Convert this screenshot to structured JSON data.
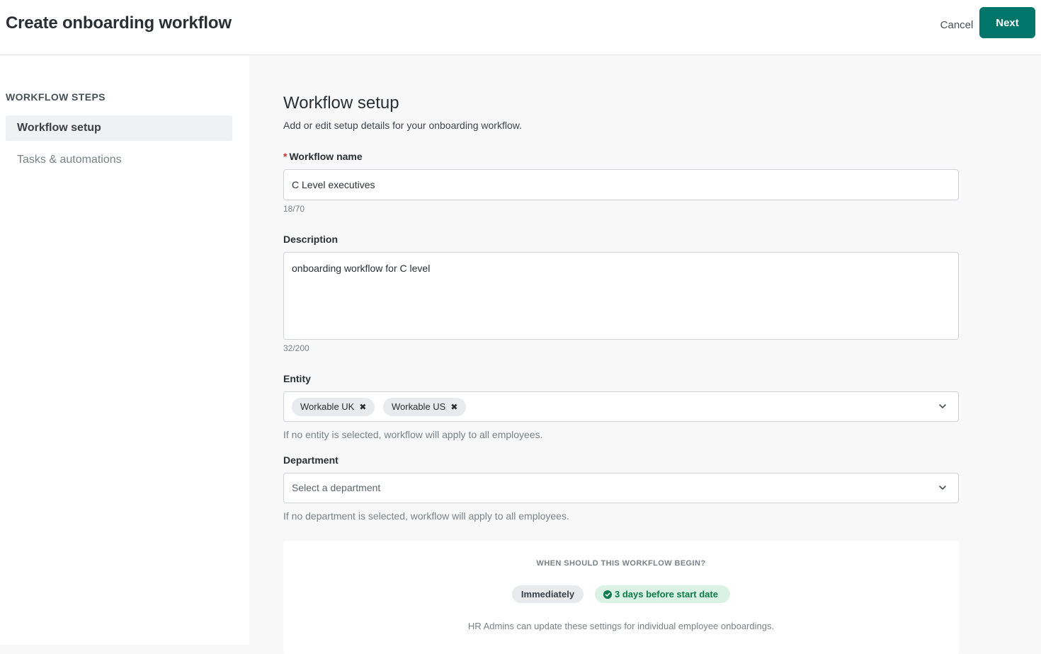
{
  "header": {
    "title": "Create onboarding workflow",
    "cancel_label": "Cancel",
    "next_label": "Next"
  },
  "sidebar": {
    "heading": "WORKFLOW STEPS",
    "items": [
      {
        "label": "Workflow setup",
        "active": true
      },
      {
        "label": "Tasks & automations",
        "active": false
      }
    ]
  },
  "main": {
    "title": "Workflow setup",
    "subtitle": "Add or edit setup details for your onboarding workflow.",
    "workflow_name": {
      "required_mark": "*",
      "label": "Workflow name",
      "value": "C Level executives",
      "counter": "18/70"
    },
    "description": {
      "label": "Description",
      "value": "onboarding workflow for C level",
      "counter": "32/200"
    },
    "entity": {
      "label": "Entity",
      "chips": [
        "Workable UK",
        "Workable US"
      ],
      "remove_glyph": "✖",
      "helper": "If no entity is selected, workflow will apply to all employees."
    },
    "department": {
      "label": "Department",
      "placeholder": "Select a department",
      "helper": "If no department is selected, workflow will apply to all employees."
    },
    "timing": {
      "heading": "WHEN SHOULD THIS WORKFLOW BEGIN?",
      "options": [
        "Immediately",
        "3 days before start date"
      ],
      "selected": "3 days before start date",
      "note": "HR Admins can update these settings for individual employee onboardings."
    }
  },
  "colors": {
    "primary": "#00756a",
    "selected_chip_bg": "#d9f2e3",
    "selected_chip_text": "#0c7a4a",
    "required": "#d0342c"
  }
}
